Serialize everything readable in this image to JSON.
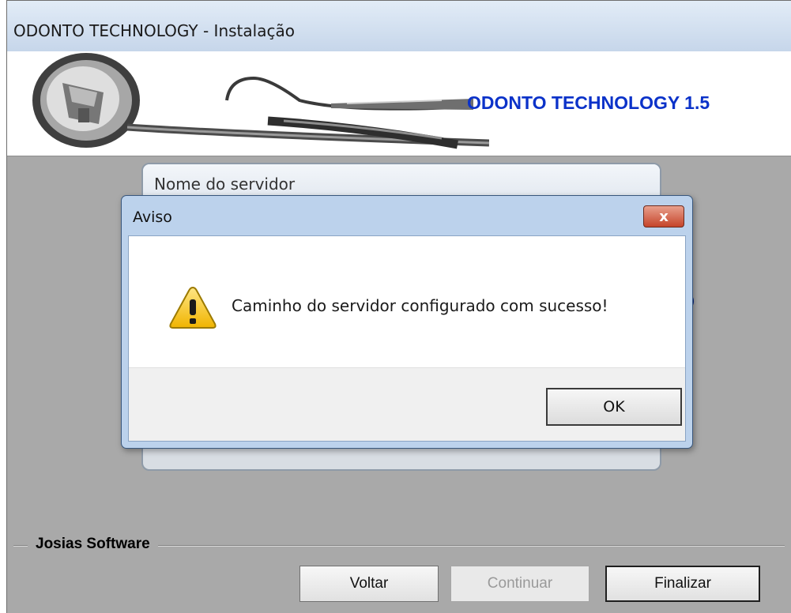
{
  "window": {
    "title": "ODONTO TECHNOLOGY - Instalação"
  },
  "banner": {
    "product_title": "ODONTO TECHNOLOGY 1.5"
  },
  "server_card": {
    "title": "Nome do servidor",
    "partial_text": ")"
  },
  "footer": {
    "group_label": "Josias Software",
    "back_label": "Voltar",
    "continue_label": "Continuar",
    "finish_label": "Finalizar"
  },
  "dialog": {
    "title": "Aviso",
    "close_label": "x",
    "message": "Caminho do servidor configurado com sucesso!",
    "ok_label": "OK",
    "icon": "warning-icon"
  },
  "colors": {
    "banner_title": "#0b32c9",
    "dialog_frame": "#bcd2ec",
    "background": "#a9a9a9"
  }
}
